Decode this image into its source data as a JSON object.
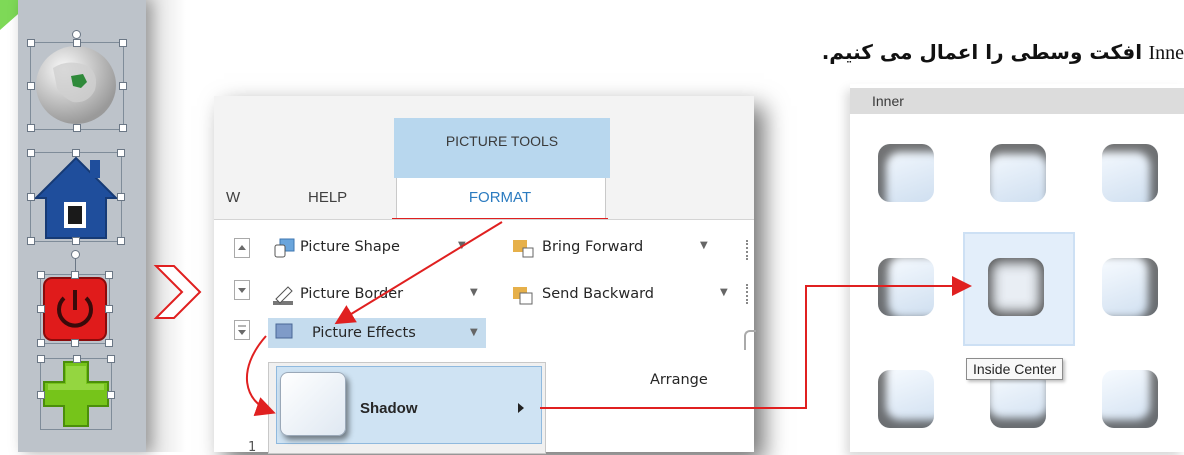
{
  "heading": {
    "persian_text": "افکت وسطی را اعمال می کنیم.",
    "english_prefix": "Inne"
  },
  "ribbon": {
    "contextual_group": "PICTURE TOOLS",
    "tabs": [
      "W",
      "HELP",
      "FORMAT"
    ],
    "active_tab": "FORMAT",
    "picture_styles": [
      {
        "label": "Picture Shape",
        "icon": "picture-shape-icon"
      },
      {
        "label": "Picture Border",
        "icon": "picture-border-icon"
      },
      {
        "label": "Picture Effects",
        "icon": "picture-effects-icon"
      }
    ],
    "arrange": [
      {
        "label": "Bring Forward",
        "icon": "bring-forward-icon"
      },
      {
        "label": "Send Backward",
        "icon": "send-backward-icon"
      }
    ],
    "arrange_group_label": "Arrange",
    "status_fragment": "1"
  },
  "effects_menu": {
    "items": [
      {
        "label": "Shadow",
        "icon": "shadow-thumbnail-icon"
      }
    ]
  },
  "shadow_gallery": {
    "section_header": "Inner",
    "selected_tooltip": "Inside Center",
    "presets_count": 9
  },
  "left_strip": {
    "shapes": [
      "globe-iran-icon",
      "house-icon",
      "power-button-icon",
      "plus-icon"
    ]
  },
  "colors": {
    "accent_blue": "#2b7bc0",
    "contextual_tab_blue": "#b8d7ee",
    "arrow_red": "#e02020",
    "strip_gray": "#bdc3ca"
  }
}
